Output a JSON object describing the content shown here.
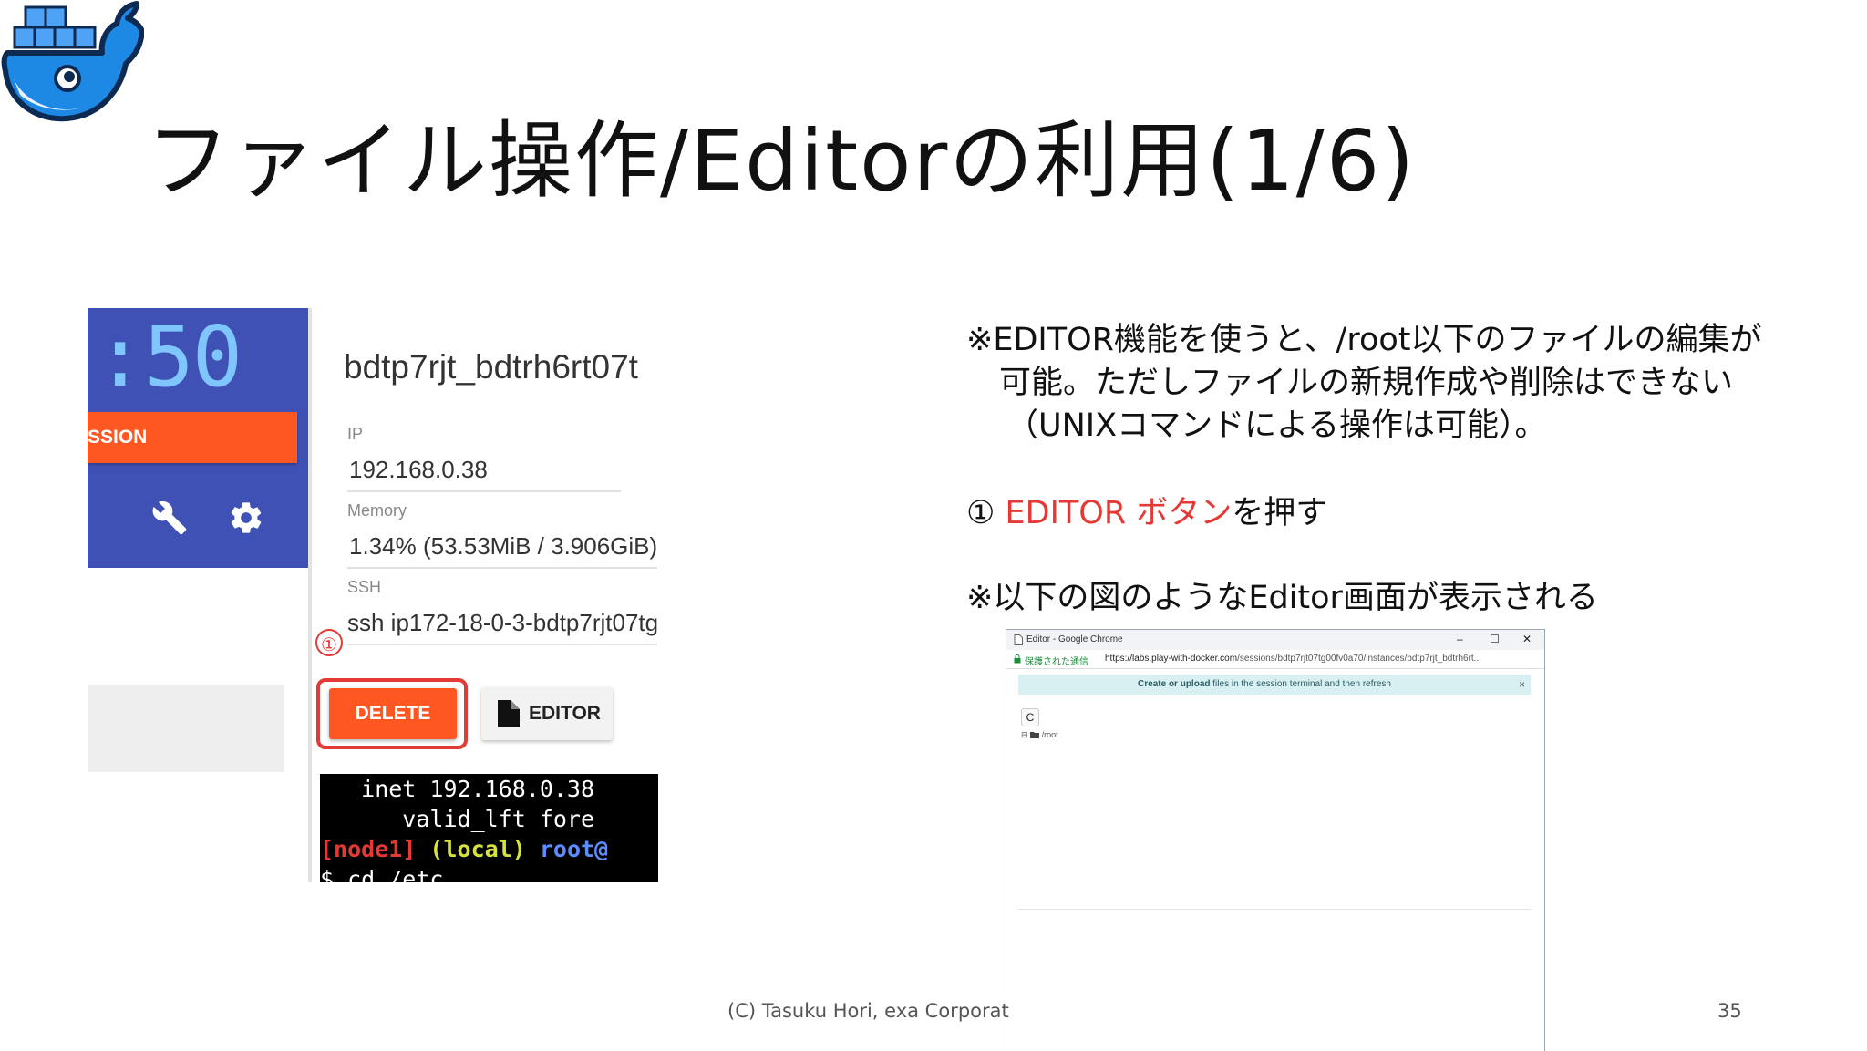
{
  "slide": {
    "title": "ファイル操作/Editorの利用(1/6)",
    "footer": "(C) Tasuku Hori, exa Corporat",
    "page_number": "35"
  },
  "screenshot": {
    "timer": ":50",
    "session_label": "SSION",
    "instance_title": "bdtp7rjt_bdtrh6rt07t",
    "ip_label": "IP",
    "ip_value": "192.168.0.38",
    "memory_label": "Memory",
    "memory_value": "1.34% (53.53MiB / 3.906GiB)",
    "ssh_label": "SSH",
    "ssh_value": "ssh ip172-18-0-3-bdtp7rjt07tg",
    "marker": "①",
    "delete_label": "DELETE",
    "editor_label": "EDITOR",
    "terminal": {
      "line1": "   inet 192.168.0.38",
      "line2": "      valid_lft fore",
      "line3_node": "[node1]",
      "line3_local": "(local)",
      "line3_root": "root@",
      "line4": "$ cd /etc"
    }
  },
  "notes": {
    "note1_line1": "※EDITOR機能を使うと、/root以下のファイルの編集が",
    "note1_line2": "可能。ただしファイルの新規作成や削除はできない",
    "note1_line3": "（UNIXコマンドによる操作は可能）。",
    "step1_marker": "①",
    "step1_red": "EDITOR ボタン",
    "step1_rest": "を押す",
    "note2": "※以下の図のようなEditor画面が表示される"
  },
  "editor_window": {
    "title": "Editor - Google Chrome",
    "minimize": "–",
    "maximize": "☐",
    "close": "✕",
    "secure_label": "保護された通信",
    "url_host": "https://labs.play-with-docker.com",
    "url_path": "/sessions/bdtp7rjt07tg00fv0a70/instances/bdtp7rjt_bdtrh6rt...",
    "alert_bold": "Create or upload",
    "alert_text": "files in the session terminal and then refresh",
    "alert_close": "×",
    "reload_icon": "C",
    "tree_expander": "⊟",
    "tree_folder": "/root"
  },
  "colors": {
    "accent_red": "#e53935",
    "header_blue": "#3f51b5",
    "button_orange": "#ff5722"
  }
}
